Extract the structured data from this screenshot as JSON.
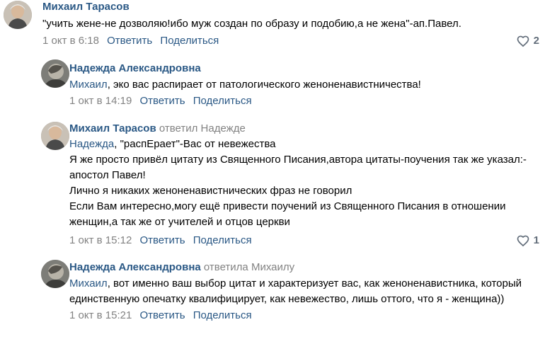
{
  "comments": [
    {
      "author": "Михаил Тарасов",
      "reply_to": "",
      "mention": "",
      "text": "\"учить жене-не дозволяю!ибо муж создан по образу и подобию,а не жена\"-ап.Павел.",
      "date": "1 окт в 6:18",
      "reply_label": "Ответить",
      "share_label": "Поделиться",
      "likes": "2"
    },
    {
      "author": "Надежда Александровна",
      "reply_to": "",
      "mention": "Михаил",
      "text": ", эко вас распирает от патологического женоненавистничества!",
      "date": "1 окт в 14:19",
      "reply_label": "Ответить",
      "share_label": "Поделиться",
      "likes": ""
    },
    {
      "author": "Михаил Тарасов",
      "reply_to": "ответил Надежде",
      "mention": "Надежда",
      "text_lines": [
        ", \"распЕрает\"-Вас от невежества",
        "Я же просто привёл цитату из Священного Писания,автора цитаты-поучения так же указал:-апостол Павел!",
        "Лично я никаких женоненавистнических фраз не говорил",
        "Если Вам интересно,могу ещё привести поучений из Священного Писания в отношении женщин,а так же от учителей и отцов церкви"
      ],
      "date": "1 окт в 15:12",
      "reply_label": "Ответить",
      "share_label": "Поделиться",
      "likes": "1"
    },
    {
      "author": "Надежда Александровна",
      "reply_to": "ответила Михаилу",
      "mention": "Михаил",
      "text": ", вот именно ваш выбор цитат и характеризует вас, как женоненавистника, который единственную опечатку квалифицирует, как невежество, лишь оттого, что я - женщина))",
      "date": "1 окт в 15:21",
      "reply_label": "Ответить",
      "share_label": "Поделиться",
      "likes": ""
    }
  ],
  "icons": {
    "like": "heart-outline-icon"
  },
  "colors": {
    "link": "#2a5885",
    "meta": "#828282",
    "text": "#000000"
  }
}
